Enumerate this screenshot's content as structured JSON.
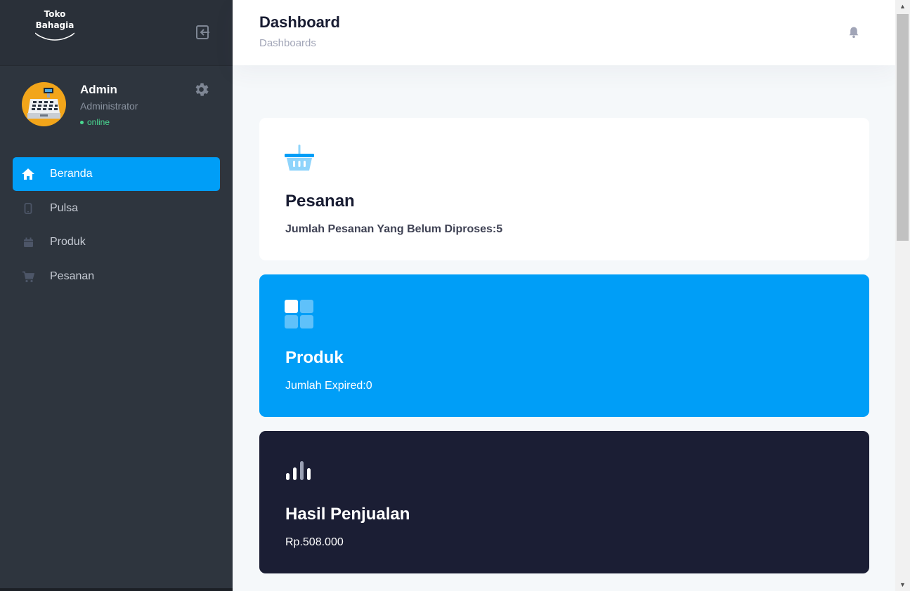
{
  "brand": {
    "line1": "Toko",
    "line2": "Bahagia"
  },
  "profile": {
    "name": "Admin",
    "role": "Administrator",
    "status": "online"
  },
  "menu": [
    {
      "label": "Beranda",
      "icon": "home-icon",
      "active": true
    },
    {
      "label": "Pulsa",
      "icon": "phone-icon",
      "active": false
    },
    {
      "label": "Produk",
      "icon": "calendar-icon",
      "active": false
    },
    {
      "label": "Pesanan",
      "icon": "cart-icon",
      "active": false
    }
  ],
  "header": {
    "title": "Dashboard",
    "subtitle": "Dashboards"
  },
  "cards": [
    {
      "title": "Pesanan",
      "desc": "Jumlah Pesanan Yang Belum Diproses:5",
      "icon": "basket-icon"
    },
    {
      "title": "Produk",
      "desc": "Jumlah Expired:0",
      "icon": "grid-icon"
    },
    {
      "title": "Hasil Penjualan",
      "desc": "Rp.508.000",
      "icon": "bar-chart-icon"
    }
  ],
  "colors": {
    "accent": "#009ef7",
    "sidebar": "#2e353e",
    "dark_card": "#1b1e34",
    "online": "#4ad991"
  }
}
